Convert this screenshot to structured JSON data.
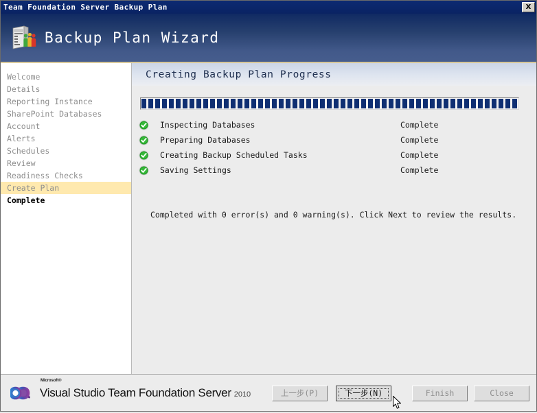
{
  "window": {
    "title": "Team Foundation Server Backup Plan",
    "close_label": "X"
  },
  "banner": {
    "title": "Backup Plan Wizard",
    "icon": "server-people-icon"
  },
  "sidebar": {
    "items": [
      {
        "label": "Welcome",
        "state": "visited"
      },
      {
        "label": "Details",
        "state": "visited"
      },
      {
        "label": "Reporting Instance",
        "state": "visited"
      },
      {
        "label": "SharePoint Databases",
        "state": "visited"
      },
      {
        "label": "Account",
        "state": "visited"
      },
      {
        "label": "Alerts",
        "state": "visited"
      },
      {
        "label": "Schedules",
        "state": "visited"
      },
      {
        "label": "Review",
        "state": "visited"
      },
      {
        "label": "Readiness Checks",
        "state": "visited"
      },
      {
        "label": "Create Plan",
        "state": "current"
      },
      {
        "label": "Complete",
        "state": "upcoming"
      }
    ]
  },
  "content": {
    "title": "Creating Backup Plan Progress",
    "progress": {
      "percent": 100,
      "style": "segmented",
      "fill_color": "#0f2f72"
    },
    "tasks": [
      {
        "label": "Inspecting Databases",
        "status": "Complete",
        "icon": "green-check-icon"
      },
      {
        "label": "Preparing Databases",
        "status": "Complete",
        "icon": "green-check-icon"
      },
      {
        "label": "Creating Backup Scheduled Tasks",
        "status": "Complete",
        "icon": "green-check-icon"
      },
      {
        "label": "Saving Settings",
        "status": "Complete",
        "icon": "green-check-icon"
      }
    ],
    "summary": "Completed with 0 error(s) and 0 warning(s). Click Next to review the results."
  },
  "footer": {
    "brand": {
      "microsoft": "Microsoft®",
      "product": "Visual Studio Team Foundation Server",
      "year": "2010",
      "logo": "visual-studio-infinity-logo"
    },
    "buttons": {
      "back": "上一步(P)",
      "next": "下一步(N)",
      "finish": "Finish",
      "close": "Close"
    }
  },
  "colors": {
    "titlebar": "#0a2363",
    "banner_top": "#102a63",
    "banner_bottom": "#465d8d",
    "banner_rule": "#d8c89a",
    "current_nav_highlight": "#ffe9ae",
    "progress_fill": "#0f2f72",
    "check_green": "#2aa82a",
    "window_bg": "#ececec"
  }
}
